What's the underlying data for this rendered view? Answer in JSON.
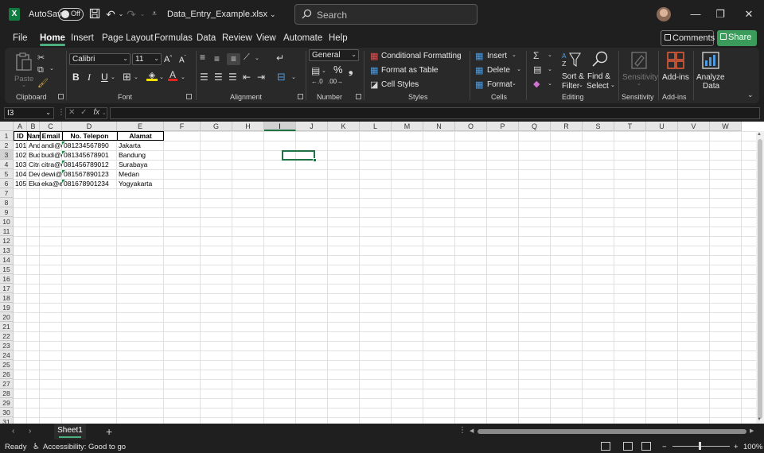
{
  "titlebar": {
    "app_icon": "X",
    "autosave_label": "AutoSave",
    "autosave_state": "Off",
    "filename": "Data_Entry_Example.xlsx",
    "search_placeholder": "Search"
  },
  "menu": {
    "tabs": [
      "File",
      "Home",
      "Insert",
      "Page Layout",
      "Formulas",
      "Data",
      "Review",
      "View",
      "Automate",
      "Help"
    ],
    "active": "Home",
    "comments": "Comments",
    "share": "Share"
  },
  "ribbon": {
    "clipboard": {
      "paste": "Paste",
      "label": "Clipboard"
    },
    "font": {
      "name": "Calibri",
      "size": "11",
      "label": "Font",
      "bold": "B",
      "italic": "I",
      "underline": "U"
    },
    "alignment": {
      "label": "Alignment"
    },
    "number": {
      "format": "General",
      "label": "Number",
      "percent": "%"
    },
    "styles": {
      "conditional": "Conditional Formatting",
      "format_table": "Format as Table",
      "cell_styles": "Cell Styles",
      "label": "Styles"
    },
    "cells": {
      "insert": "Insert",
      "delete": "Delete",
      "format": "Format",
      "label": "Cells"
    },
    "editing": {
      "sort1": "Sort &",
      "sort2": "Filter",
      "find1": "Find &",
      "find2": "Select",
      "label": "Editing"
    },
    "sensitivity": {
      "btn": "Sensitivity",
      "label": "Sensitivity"
    },
    "addins": {
      "btn": "Add-ins",
      "label": "Add-ins"
    },
    "analyze": {
      "btn1": "Analyze",
      "btn2": "Data"
    }
  },
  "formula_bar": {
    "name_box": "I3",
    "fx": "fx",
    "value": ""
  },
  "sheet": {
    "columns": [
      "A",
      "B",
      "C",
      "D",
      "E",
      "F",
      "G",
      "H",
      "I",
      "J",
      "K",
      "L",
      "M",
      "N",
      "O",
      "P",
      "Q",
      "R",
      "S",
      "T",
      "U",
      "V",
      "W"
    ],
    "selected_column": "I",
    "selected_row": 3,
    "rows": [
      "1",
      "2",
      "3",
      "4",
      "5",
      "6",
      "7",
      "8",
      "9",
      "10",
      "11",
      "12",
      "13",
      "14",
      "15",
      "16",
      "17",
      "18",
      "19",
      "20",
      "21",
      "22",
      "23",
      "24",
      "25",
      "26",
      "27",
      "28",
      "29",
      "30",
      "31"
    ],
    "table": {
      "headers": [
        "ID",
        "Nama",
        "Email",
        "No. Telepon",
        "Alamat"
      ],
      "rows": [
        [
          "101",
          "Andi",
          "andi@email.com",
          "081234567890",
          "Jakarta"
        ],
        [
          "102",
          "Budi",
          "budi@email.com",
          "081345678901",
          "Bandung"
        ],
        [
          "103",
          "Citra",
          "citra@email.com",
          "081456789012",
          "Surabaya"
        ],
        [
          "104",
          "Dewi",
          "dewi@email.com",
          "081567890123",
          "Medan"
        ],
        [
          "105",
          "Eka",
          "eka@email.com",
          "081678901234",
          "Yogyakarta"
        ]
      ]
    }
  },
  "sheet_tabs": {
    "tabs": [
      "Sheet1"
    ],
    "active": "Sheet1"
  },
  "status": {
    "ready": "Ready",
    "accessibility": "Accessibility: Good to go",
    "zoom": "100%"
  }
}
